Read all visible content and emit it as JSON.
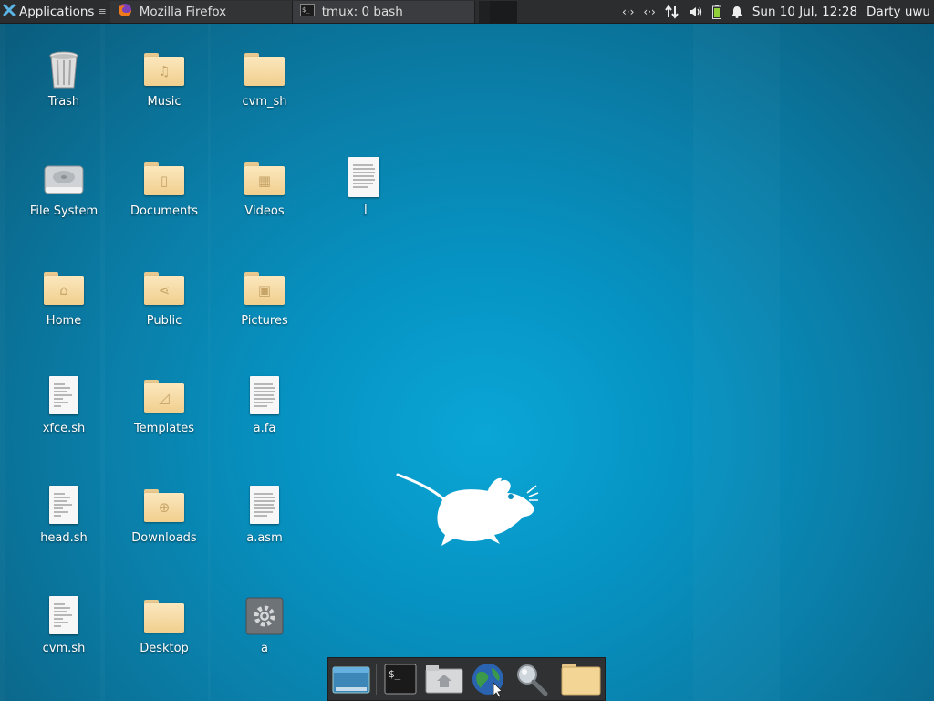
{
  "panel": {
    "apps_label": "Applications",
    "tasks": [
      {
        "label": "Mozilla Firefox"
      },
      {
        "label": "tmux: 0 bash"
      }
    ],
    "clock": "Sun 10 Jul, 12:28",
    "user": "Darty uwu",
    "tray_icons": [
      "network-arrows-icon",
      "network-arrows-icon",
      "network-transfer-icon",
      "volume-icon",
      "battery-icon",
      "notification-bell-icon"
    ]
  },
  "desktop": {
    "icons": [
      {
        "label": "Trash",
        "icon": "trash-icon"
      },
      {
        "label": "Music",
        "icon": "music-folder-icon"
      },
      {
        "label": "cvm_sh",
        "icon": "folder-icon"
      },
      {
        "label": "File System",
        "icon": "drive-icon"
      },
      {
        "label": "Documents",
        "icon": "documents-folder-icon"
      },
      {
        "label": "Videos",
        "icon": "videos-folder-icon"
      },
      {
        "label": "]",
        "icon": "text-file-icon"
      },
      {
        "label": "Home",
        "icon": "home-folder-icon"
      },
      {
        "label": "Public",
        "icon": "public-folder-icon"
      },
      {
        "label": "Pictures",
        "icon": "pictures-folder-icon"
      },
      {
        "label": "xfce.sh",
        "icon": "script-file-icon"
      },
      {
        "label": "Templates",
        "icon": "templates-folder-icon"
      },
      {
        "label": "a.fa",
        "icon": "text-file-icon"
      },
      {
        "label": "head.sh",
        "icon": "script-file-icon"
      },
      {
        "label": "Downloads",
        "icon": "downloads-folder-icon"
      },
      {
        "label": "a.asm",
        "icon": "text-file-icon"
      },
      {
        "label": "cvm.sh",
        "icon": "script-file-icon"
      },
      {
        "label": "Desktop",
        "icon": "folder-icon"
      },
      {
        "label": "a",
        "icon": "executable-gear-icon"
      }
    ]
  },
  "dock": {
    "items": [
      "show-desktop-icon",
      "terminal-icon",
      "file-manager-home-icon",
      "web-browser-globe-icon",
      "search-magnifier-icon",
      "folder-icon"
    ]
  },
  "colors": {
    "wallpaper": "#0893c3",
    "panel": "#2b2d2f",
    "folder": "#f5d89e"
  }
}
